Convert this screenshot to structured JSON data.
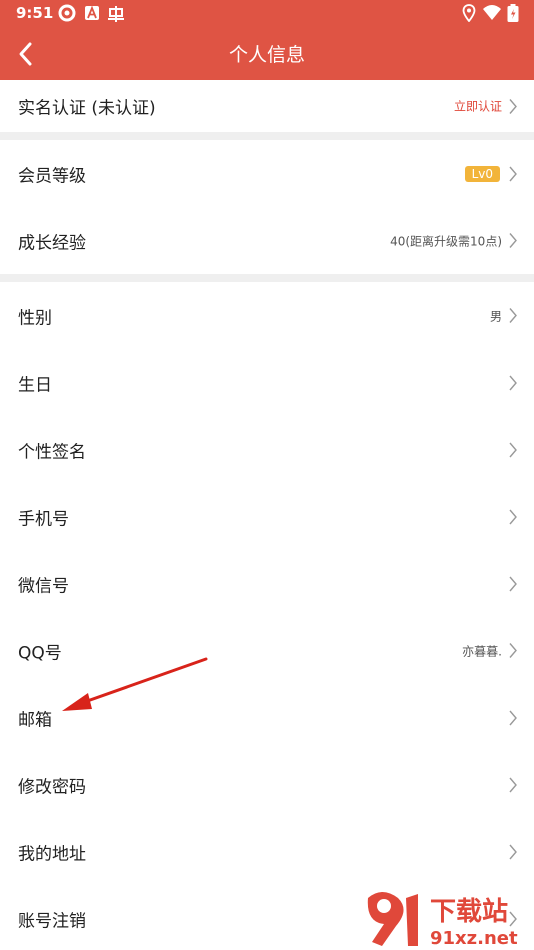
{
  "status": {
    "time": "9:51"
  },
  "header": {
    "title": "个人信息"
  },
  "rows_group1": [
    {
      "name": "row-real-name",
      "label": "实名认证 (未认证)",
      "value": "立即认证",
      "value_style": "red"
    }
  ],
  "rows_group2": [
    {
      "name": "row-member-level",
      "label": "会员等级",
      "badge": "Lv0"
    },
    {
      "name": "row-growth",
      "label": "成长经验",
      "value": "40(距离升级需10点)"
    }
  ],
  "rows_group3": [
    {
      "name": "row-gender",
      "label": "性别",
      "value": "男"
    },
    {
      "name": "row-birthday",
      "label": "生日",
      "value": ""
    },
    {
      "name": "row-signature",
      "label": "个性签名",
      "value": ""
    },
    {
      "name": "row-phone",
      "label": "手机号",
      "value": ""
    },
    {
      "name": "row-wechat",
      "label": "微信号",
      "value": ""
    },
    {
      "name": "row-qq",
      "label": "QQ号",
      "value": "亦暮暮."
    },
    {
      "name": "row-email",
      "label": "邮箱",
      "value": ""
    },
    {
      "name": "row-password",
      "label": "修改密码",
      "value": ""
    },
    {
      "name": "row-address",
      "label": "我的地址",
      "value": ""
    },
    {
      "name": "row-cancel-account",
      "label": "账号注销",
      "value": ""
    }
  ],
  "watermark": {
    "brand": "下载站",
    "url": "91xz.net"
  },
  "colors": {
    "header": "#df5444",
    "accent_red": "#e0483a",
    "badge": "#f2b43a",
    "separator": "#efefef"
  }
}
